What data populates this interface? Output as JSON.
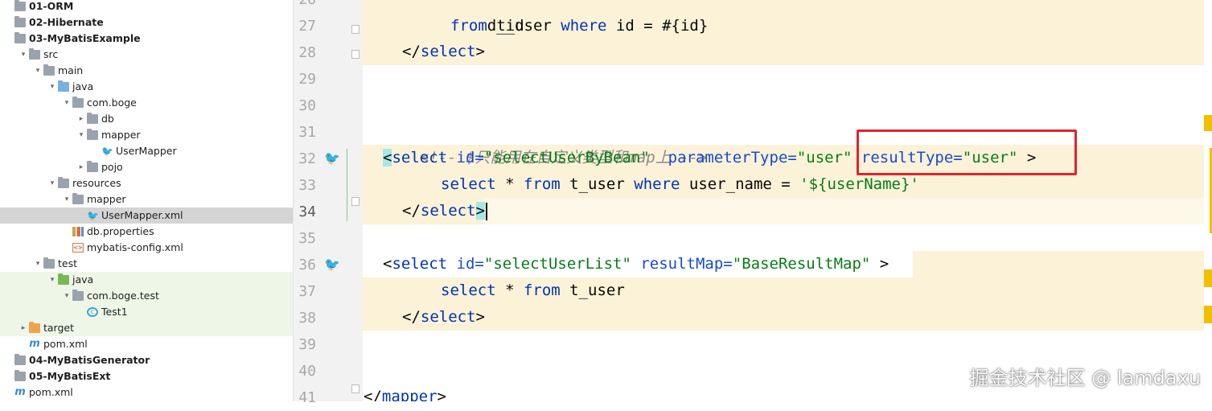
{
  "tree": [
    {
      "label": "01-ORM",
      "bold": true,
      "indent": 0,
      "arrow": "",
      "icon": "module-folder-icon"
    },
    {
      "label": "02-Hibernate",
      "bold": true,
      "indent": 0,
      "arrow": "",
      "icon": "module-folder-icon"
    },
    {
      "label": "03-MyBatisExample",
      "bold": true,
      "indent": 0,
      "arrow": "",
      "icon": "module-folder-icon"
    },
    {
      "label": "src",
      "indent": 1,
      "arrow": "down",
      "icon": "folder-icon"
    },
    {
      "label": "main",
      "indent": 2,
      "arrow": "down",
      "icon": "folder-icon"
    },
    {
      "label": "java",
      "indent": 3,
      "arrow": "down",
      "icon": "source-folder-icon"
    },
    {
      "label": "com.boge",
      "indent": 4,
      "arrow": "down",
      "icon": "package-icon"
    },
    {
      "label": "db",
      "indent": 5,
      "arrow": "right",
      "icon": "package-icon"
    },
    {
      "label": "mapper",
      "indent": 5,
      "arrow": "down",
      "icon": "package-icon"
    },
    {
      "label": "UserMapper",
      "indent": 6,
      "arrow": "",
      "icon": "mybatis-bird-icon"
    },
    {
      "label": "pojo",
      "indent": 5,
      "arrow": "right",
      "icon": "package-icon"
    },
    {
      "label": "resources",
      "indent": 3,
      "arrow": "down",
      "icon": "resources-folder-icon"
    },
    {
      "label": "mapper",
      "indent": 4,
      "arrow": "down",
      "icon": "folder-icon"
    },
    {
      "label": "UserMapper.xml",
      "indent": 5,
      "arrow": "",
      "icon": "mybatis-bird-icon",
      "selected": true
    },
    {
      "label": "db.properties",
      "indent": 4,
      "arrow": "",
      "icon": "properties-file-icon"
    },
    {
      "label": "mybatis-config.xml",
      "indent": 4,
      "arrow": "",
      "icon": "xml-file-icon"
    },
    {
      "label": "test",
      "indent": 2,
      "arrow": "down",
      "icon": "folder-icon"
    },
    {
      "label": "java",
      "indent": 3,
      "arrow": "down",
      "icon": "test-folder-icon",
      "test": true
    },
    {
      "label": "com.boge.test",
      "indent": 4,
      "arrow": "down",
      "icon": "package-icon",
      "test": true
    },
    {
      "label": "Test1",
      "indent": 5,
      "arrow": "",
      "icon": "class-icon",
      "test": true
    },
    {
      "label": "target",
      "indent": 1,
      "arrow": "right",
      "icon": "excluded-folder-icon",
      "test": true
    },
    {
      "label": "pom.xml",
      "indent": 1,
      "arrow": "",
      "icon": "maven-file-icon"
    },
    {
      "label": "04-MyBatisGenerator",
      "bold": true,
      "indent": 0,
      "arrow": "",
      "icon": "module-folder-icon"
    },
    {
      "label": "05-MyBatisExt",
      "bold": true,
      "indent": 0,
      "arrow": "",
      "icon": "module-folder-icon"
    },
    {
      "label": "pom.xml",
      "indent": 0,
      "arrow": "",
      "icon": "maven-file-icon"
    }
  ],
  "gutter": {
    "line_numbers": [
      "26",
      "27",
      "28",
      "29",
      "30",
      "31",
      "32",
      "33",
      "34",
      "35",
      "36",
      "37",
      "38",
      "39",
      "40",
      "41"
    ],
    "current_line": "34",
    "gutter_icons": [
      {
        "line": "32",
        "icon": "mybatis-bird-icon"
      },
      {
        "line": "36",
        "icon": "mybatis-bird-icon"
      }
    ]
  },
  "editor": {
    "line26": "d_id",
    "line27": {
      "kw1": "from",
      "t1": " t_user ",
      "kw2": "where",
      "t2": " id = #{id}"
    },
    "line28": {
      "open": "</",
      "name": "select",
      "close": ">"
    },
    "line31": "<!-- $只能用在自定义类型和map上 -->",
    "line32": {
      "open": "<",
      "name": "select",
      "attr1": "id=",
      "val1": "\"selectUserByBean\"",
      "attr2": "parameterType=",
      "val2": "\"user\"",
      "attr3": "resultType=",
      "val3": "\"user\"",
      "close": ">"
    },
    "line33": {
      "kw1": "select",
      "t1": " * ",
      "kw2": "from",
      "t2": " t_user ",
      "kw3": "where",
      "t3": " user_name = ",
      "val": "'${userName}'"
    },
    "line34": {
      "open": "</",
      "name": "select",
      "close": ">"
    },
    "line36": {
      "open": "<",
      "name": "select",
      "attr1": "id=",
      "val1": "\"selectUserList\"",
      "attr2": "resultMap=",
      "val2": "\"BaseResultMap\"",
      "close": ">"
    },
    "line37": {
      "kw1": "select",
      "t1": " * ",
      "kw2": "from",
      "t2": " t_user"
    },
    "line38": {
      "open": "</",
      "name": "select",
      "close": ">"
    },
    "line41": {
      "open": "</",
      "name": "mapper",
      "close": ">"
    }
  },
  "watermark": "掘金技术社区 @ lamdaxu",
  "colors": {
    "tag": "#0033b3",
    "string": "#067d17",
    "comment": "#8c8c8c",
    "highlight_band": "#fbf2d8",
    "annotation_box": "#e0232c"
  }
}
